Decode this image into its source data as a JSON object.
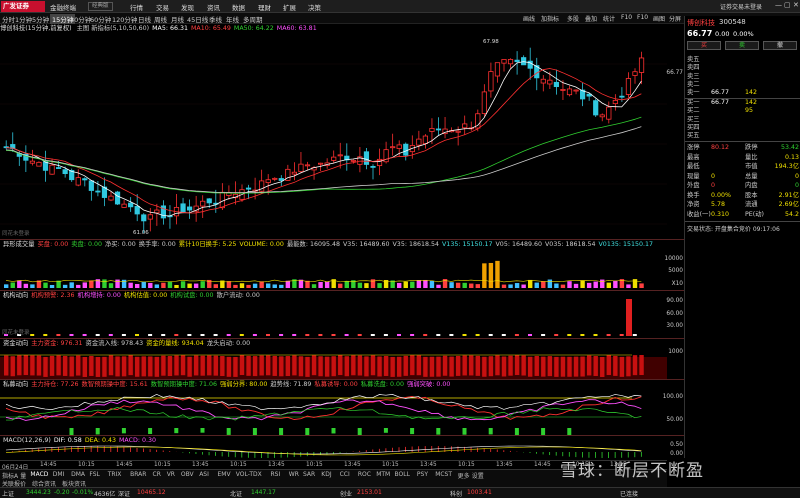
{
  "header": {
    "logo": "广发证券",
    "app_name": "金融终端",
    "edition": "经典版",
    "nav": [
      "行情",
      "交易",
      "发现",
      "资讯",
      "数据",
      "理财",
      "扩展",
      "决策"
    ],
    "account": "证券交易未登录",
    "win_controls": [
      "—",
      "▢",
      "✕"
    ]
  },
  "toolbar": {
    "stock_title": "博创科技(15分钟,前复权)",
    "timeframes": [
      "分时",
      "1分钟",
      "5分钟",
      "15分钟",
      "30分钟",
      "60分钟",
      "120分钟",
      "日线",
      "周线",
      "月线",
      "45日线",
      "季线",
      "年线",
      "多周期"
    ],
    "active_tf": "15分钟",
    "buttons": [
      "画线",
      "加指标",
      "多股",
      "叠加",
      "统计",
      "F10",
      "F10",
      "画图",
      "分屏"
    ]
  },
  "kline": {
    "ma_legend": [
      {
        "t": "主图 新指标(5,10,50,60)",
        "c": "#ccc"
      },
      {
        "t": "MA5: 66.31",
        "c": "#fff"
      },
      {
        "t": "MA10: 65.49",
        "c": "#ff4040"
      },
      {
        "t": "MA50: 64.22",
        "c": "#30d030"
      },
      {
        "t": "MA60: 63.81",
        "c": "#ff50ff"
      }
    ],
    "high_label": "67.98",
    "low_label": "61.06",
    "price_axis": "66.77",
    "watermark_label": "同花未登录"
  },
  "vol": {
    "legend": [
      {
        "t": "异形成交量",
        "c": "#ddd"
      },
      {
        "t": "买盘: 0.00",
        "c": "#ff4040"
      },
      {
        "t": "卖盘: 0.00",
        "c": "#30d030"
      },
      {
        "t": "净买: 0.00",
        "c": "#ccc"
      },
      {
        "t": "换手率: 0.00",
        "c": "#ccc"
      },
      {
        "t": "累计10日换手: 5.25",
        "c": "#f0e000"
      },
      {
        "t": "VOLUME: 0.00",
        "c": "#f0e000"
      },
      {
        "t": "最能数: 16095.48",
        "c": "#ccc"
      },
      {
        "t": "V35: 16489.60",
        "c": "#ccc"
      },
      {
        "t": "V35: 18618.54",
        "c": "#ccc"
      },
      {
        "t": "V135: 15150.17",
        "c": "#40e0e0"
      },
      {
        "t": "V05: 16489.60",
        "c": "#ccc"
      },
      {
        "t": "V035: 18618.54",
        "c": "#ccc"
      },
      {
        "t": "V0135: 15150.17",
        "c": "#40e0e0"
      }
    ],
    "yticks": [
      "10000",
      "5000",
      "X10"
    ]
  },
  "inst": {
    "legend": [
      {
        "t": "机构动向",
        "c": "#ddd"
      },
      {
        "t": "机构预警: 2.36",
        "c": "#ff4040"
      },
      {
        "t": "机构增持: 0.00",
        "c": "#ff50ff"
      },
      {
        "t": "机构估值: 0.00",
        "c": "#f0e000"
      },
      {
        "t": "机构试盘: 0.00",
        "c": "#30d030"
      },
      {
        "t": "散户流动: 0.00",
        "c": "#ccc"
      }
    ],
    "yticks": [
      "90.00",
      "60.00",
      "30.00"
    ],
    "watermark_label": "同花未登录"
  },
  "fund": {
    "legend": [
      {
        "t": "资金动向",
        "c": "#ddd"
      },
      {
        "t": "主力资金: 976.31",
        "c": "#ff4040"
      },
      {
        "t": "资金流入线: 978.43",
        "c": "#ccc"
      },
      {
        "t": "资金的量线: 934.04",
        "c": "#f0e000"
      },
      {
        "t": "龙头启动: 0.00",
        "c": "#ccc"
      }
    ],
    "yticks": [
      "1000"
    ]
  },
  "chip": {
    "legend": [
      {
        "t": "私募动向",
        "c": "#ddd"
      },
      {
        "t": "主力持仓: 77.26",
        "c": "#ff4040"
      },
      {
        "t": "数智预期操中度: 15.61",
        "c": "#ff4040"
      },
      {
        "t": "数智预期操中度: 71.06",
        "c": "#30d030"
      },
      {
        "t": "强弱分界: 80.00",
        "c": "#f0e000"
      },
      {
        "t": "趋势线: 71.89",
        "c": "#ccc"
      },
      {
        "t": "私募诱导: 0.00",
        "c": "#ff4040"
      },
      {
        "t": "私募洗盘: 0.00",
        "c": "#30d030"
      },
      {
        "t": "强弱突破: 0.00",
        "c": "#ff50ff"
      }
    ],
    "yticks": [
      "100.00",
      "50.00"
    ]
  },
  "macd": {
    "legend": [
      {
        "t": "MACD(12,26,9)",
        "c": "#ddd"
      },
      {
        "t": "DIF: 0.58",
        "c": "#fff"
      },
      {
        "t": "DEA: 0.43",
        "c": "#f0e000"
      },
      {
        "t": "MACD: 0.30",
        "c": "#ff50ff"
      }
    ],
    "yticks": [
      "0.50",
      "0.00"
    ]
  },
  "time_axis": [
    "06月24日",
    "14:45",
    "10:15",
    "14:45",
    "10:15",
    "13:45",
    "10:15",
    "13:45",
    "10:15",
    "13:45",
    "10:15",
    "13:45",
    "10:15",
    "13:45",
    "14:45",
    "10:15",
    "13:15"
  ],
  "ind_tabs": [
    "指标A",
    "量",
    "MACD",
    "DMI",
    "DMA",
    "FSL",
    "TRIX",
    "BRAR",
    "CR",
    "VR",
    "OBV",
    "ASI",
    "EMV",
    "VOL-TDX",
    "RSI",
    "WR",
    "SAR",
    "KDJ",
    "CCI",
    "ROC",
    "MTM",
    "BOLL",
    "PSY",
    "MCST",
    "更多",
    "设置"
  ],
  "ind_tabs2": [
    "关联报价",
    "综合资讯",
    "板块资讯"
  ],
  "status": [
    {
      "t": "上证",
      "c": "#ccc"
    },
    {
      "t": "3444.23",
      "c": "#30d030"
    },
    {
      "t": "-0.20",
      "c": "#30d030"
    },
    {
      "t": "-0.01%",
      "c": "#30d030"
    },
    {
      "t": "4636亿",
      "c": "#ccc"
    },
    {
      "t": "深证",
      "c": "#ccc"
    },
    {
      "t": "10465.12",
      "c": "#ff4040"
    },
    {
      "t": "北证",
      "c": "#ccc"
    },
    {
      "t": "1447.17",
      "c": "#30d030"
    },
    {
      "t": "创业",
      "c": "#ccc"
    },
    {
      "t": "2153.01",
      "c": "#ff4040"
    },
    {
      "t": "科创",
      "c": "#ccc"
    },
    {
      "t": "1003.41",
      "c": "#ff4040"
    },
    {
      "t": "已连接",
      "c": "#ccc"
    }
  ],
  "watermark": "雪球：断层不断盈",
  "quote": {
    "name": "博创科技",
    "code": "300548",
    "price": "66.77",
    "change": "0.00",
    "pct": "0.00%",
    "buttons": [
      "买",
      "卖",
      "撤"
    ],
    "asks": [
      {
        "l": "卖五",
        "v": "",
        "q": ""
      },
      {
        "l": "卖四",
        "v": "",
        "q": ""
      },
      {
        "l": "卖三",
        "v": "",
        "q": ""
      },
      {
        "l": "卖二",
        "v": "",
        "q": ""
      },
      {
        "l": "卖一",
        "v": "66.77",
        "q": "142"
      }
    ],
    "bids": [
      {
        "l": "买一",
        "v": "66.77",
        "q": "142"
      },
      {
        "l": "买二",
        "v": "",
        "q": "95"
      },
      {
        "l": "买三",
        "v": "",
        "q": ""
      },
      {
        "l": "买四",
        "v": "",
        "q": ""
      },
      {
        "l": "买五",
        "v": "",
        "q": ""
      }
    ],
    "stats": [
      {
        "l": "涨停",
        "v": "80.12",
        "vc": "#ff4040",
        "r": "跌停",
        "rv": "53.42",
        "rc": "#30d030"
      },
      {
        "l": "最高",
        "v": "",
        "vc": "#ccc",
        "r": "量比",
        "rv": "0.13",
        "rc": "#f0e000"
      },
      {
        "l": "最低",
        "v": "",
        "vc": "#ccc",
        "r": "市值",
        "rv": "194.3亿",
        "rc": "#f0e000"
      },
      {
        "l": "现量",
        "v": "0",
        "vc": "#f0e000",
        "r": "总量",
        "rv": "0",
        "rc": "#f0e000"
      },
      {
        "l": "外盘",
        "v": "0",
        "vc": "#ff4040",
        "r": "内盘",
        "rv": "0",
        "rc": "#30d030"
      },
      {
        "l": "换手",
        "v": "0.00%",
        "vc": "#f0e000",
        "r": "股本",
        "rv": "2.91亿",
        "rc": "#f0e000"
      },
      {
        "l": "净资",
        "v": "5.78",
        "vc": "#f0e000",
        "r": "流通",
        "rv": "2.69亿",
        "rc": "#f0e000"
      },
      {
        "l": "收益(一)",
        "v": "0.310",
        "vc": "#f0e000",
        "r": "PE(动)",
        "rv": "54.2",
        "rc": "#f0e000"
      }
    ],
    "trade_status": "交易状态: 开盘集合竞价 09:17:06"
  }
}
